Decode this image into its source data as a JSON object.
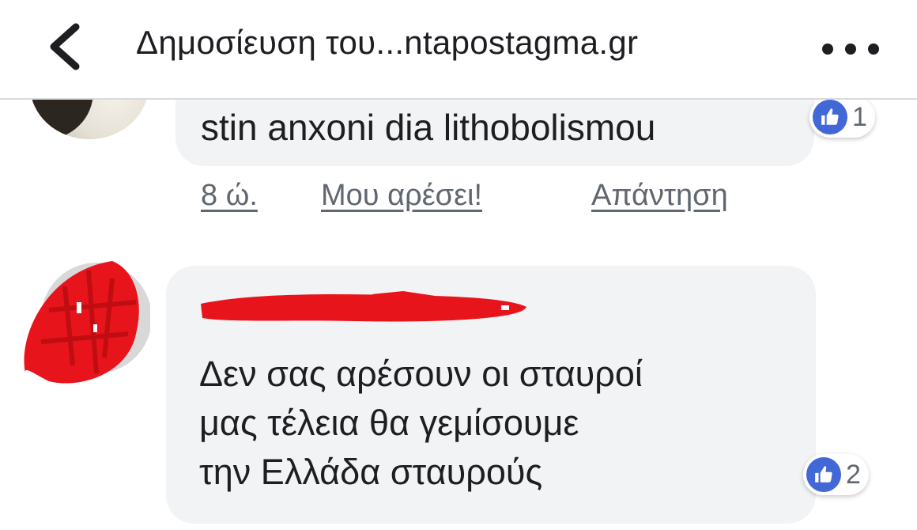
{
  "header": {
    "back_icon": "chevron-left-icon",
    "title": "Δημοσίευση του...ntapostagma.gr",
    "more_icon": "more-dots-icon"
  },
  "comments": [
    {
      "text": "stin anxoni dia lithobolismou",
      "reactions": {
        "icon": "like-icon",
        "count": "1"
      },
      "actions": {
        "time": "8 ώ.",
        "like": "Μου αρέσει!",
        "reply": "Απάντηση"
      }
    },
    {
      "author_redacted": true,
      "text_lines": [
        "Δεν σας αρέσουν οι σταυροί",
        "μας τέλεια θα  γεμίσουμε",
        "την Ελλάδα σταυρούς"
      ],
      "reactions": {
        "icon": "like-icon",
        "count": "2"
      }
    }
  ],
  "colors": {
    "bubble": "#f2f3f5",
    "like_blue": "#4267d6",
    "redaction_red": "#e8141b",
    "secondary_text": "#606770"
  }
}
